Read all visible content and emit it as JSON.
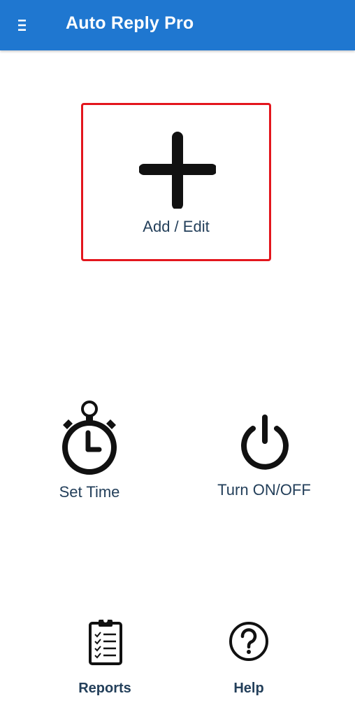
{
  "appbar": {
    "title": "Auto Reply Pro",
    "menu_icon": "hamburger-menu-icon"
  },
  "main": {
    "add_edit": {
      "label": "Add / Edit",
      "icon": "plus-icon"
    },
    "set_time": {
      "label": "Set Time",
      "icon": "stopwatch-icon"
    },
    "turn_on_off": {
      "label": "Turn ON/OFF",
      "icon": "power-icon"
    },
    "reports": {
      "label": "Reports",
      "icon": "clipboard-checklist-icon"
    },
    "help": {
      "label": "Help",
      "icon": "question-mark-circle-icon"
    }
  },
  "colors": {
    "accent": "#1f77d0",
    "highlight_border": "#e3161d",
    "label_text": "#233f5a",
    "icon": "#111111"
  }
}
